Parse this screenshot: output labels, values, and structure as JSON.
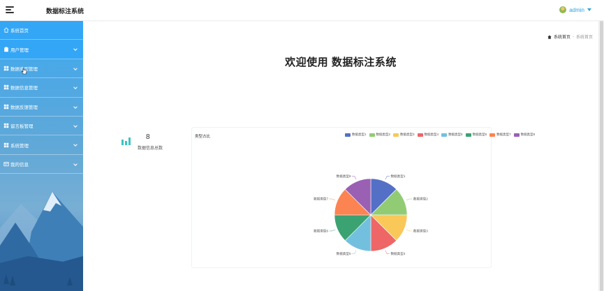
{
  "header": {
    "app_title": "数据标注系统",
    "user_name": "admin"
  },
  "sidebar": {
    "items": [
      {
        "label": "系统首页",
        "icon": "home-icon",
        "expandable": false,
        "active": true
      },
      {
        "label": "用户管理",
        "icon": "user-manage-icon",
        "expandable": true,
        "active": true
      },
      {
        "label": "数据类型管理",
        "icon": "grid-icon",
        "expandable": true,
        "active": false
      },
      {
        "label": "数据信息管理",
        "icon": "grid-icon",
        "expandable": true,
        "active": false
      },
      {
        "label": "数据反馈管理",
        "icon": "grid-icon",
        "expandable": true,
        "active": false
      },
      {
        "label": "留言板管理",
        "icon": "grid-icon",
        "expandable": true,
        "active": false
      },
      {
        "label": "系统管理",
        "icon": "grid-icon",
        "expandable": true,
        "active": false
      },
      {
        "label": "我的信息",
        "icon": "profile-card-icon",
        "expandable": true,
        "active": false
      }
    ]
  },
  "breadcrumb": {
    "home": "系统首页",
    "separator": "-",
    "current": "系统首页"
  },
  "main": {
    "welcome": "欢迎使用 数据标注系统",
    "stat_value": "8",
    "stat_label": "数据信息总数"
  },
  "colors": {
    "accent": "#27a4e0",
    "stat_icon": "#3cc3c3"
  },
  "chart_data": {
    "type": "pie",
    "title": "类型占比",
    "categories": [
      "数据类型1",
      "数据类型2",
      "数据类型3",
      "数据类型4",
      "数据类型5",
      "数据类型6",
      "数据类型7",
      "数据类型8"
    ],
    "values": [
      1,
      1,
      1,
      1,
      1,
      1,
      1,
      1
    ],
    "colors": [
      "#5470c6",
      "#91cc75",
      "#fac858",
      "#ee6666",
      "#73c0de",
      "#3ba272",
      "#fc8452",
      "#9a60b4"
    ],
    "legend_position": "top-right"
  }
}
